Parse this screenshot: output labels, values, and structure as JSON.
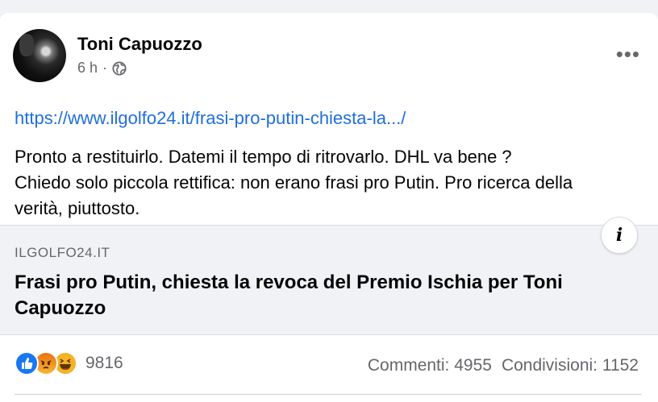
{
  "post": {
    "author": "Toni Capuozzo",
    "time": "6 h",
    "separator": "·",
    "link": "https://www.ilgolfo24.it/frasi-pro-putin-chiesta-la.../",
    "text_lines": [
      "Pronto a restituirlo. Datemi il tempo di ritrovarlo. DHL va bene ?",
      "Chiedo solo piccola rettifica: non erano frasi pro Putin. Pro ricerca della",
      "verità, piuttosto."
    ],
    "more_label": "•••"
  },
  "preview": {
    "domain": "ILGOLFO24.IT",
    "title": "Frasi pro Putin, chiesta la revoca del Premio Ischia per Toni Capuozzo",
    "info_label": "i"
  },
  "footer": {
    "reaction_icons": [
      "like-icon",
      "angry-icon",
      "haha-icon"
    ],
    "reaction_count": "9816",
    "comments": "Commenti: 4955",
    "shares": "Condivisioni: 1152"
  },
  "colors": {
    "link": "#216fdb",
    "like": "#1877f2",
    "angry": "#e9710f",
    "haha": "#f7b125",
    "muted": "#65676b",
    "preview_bg": "#f0f2f5"
  }
}
